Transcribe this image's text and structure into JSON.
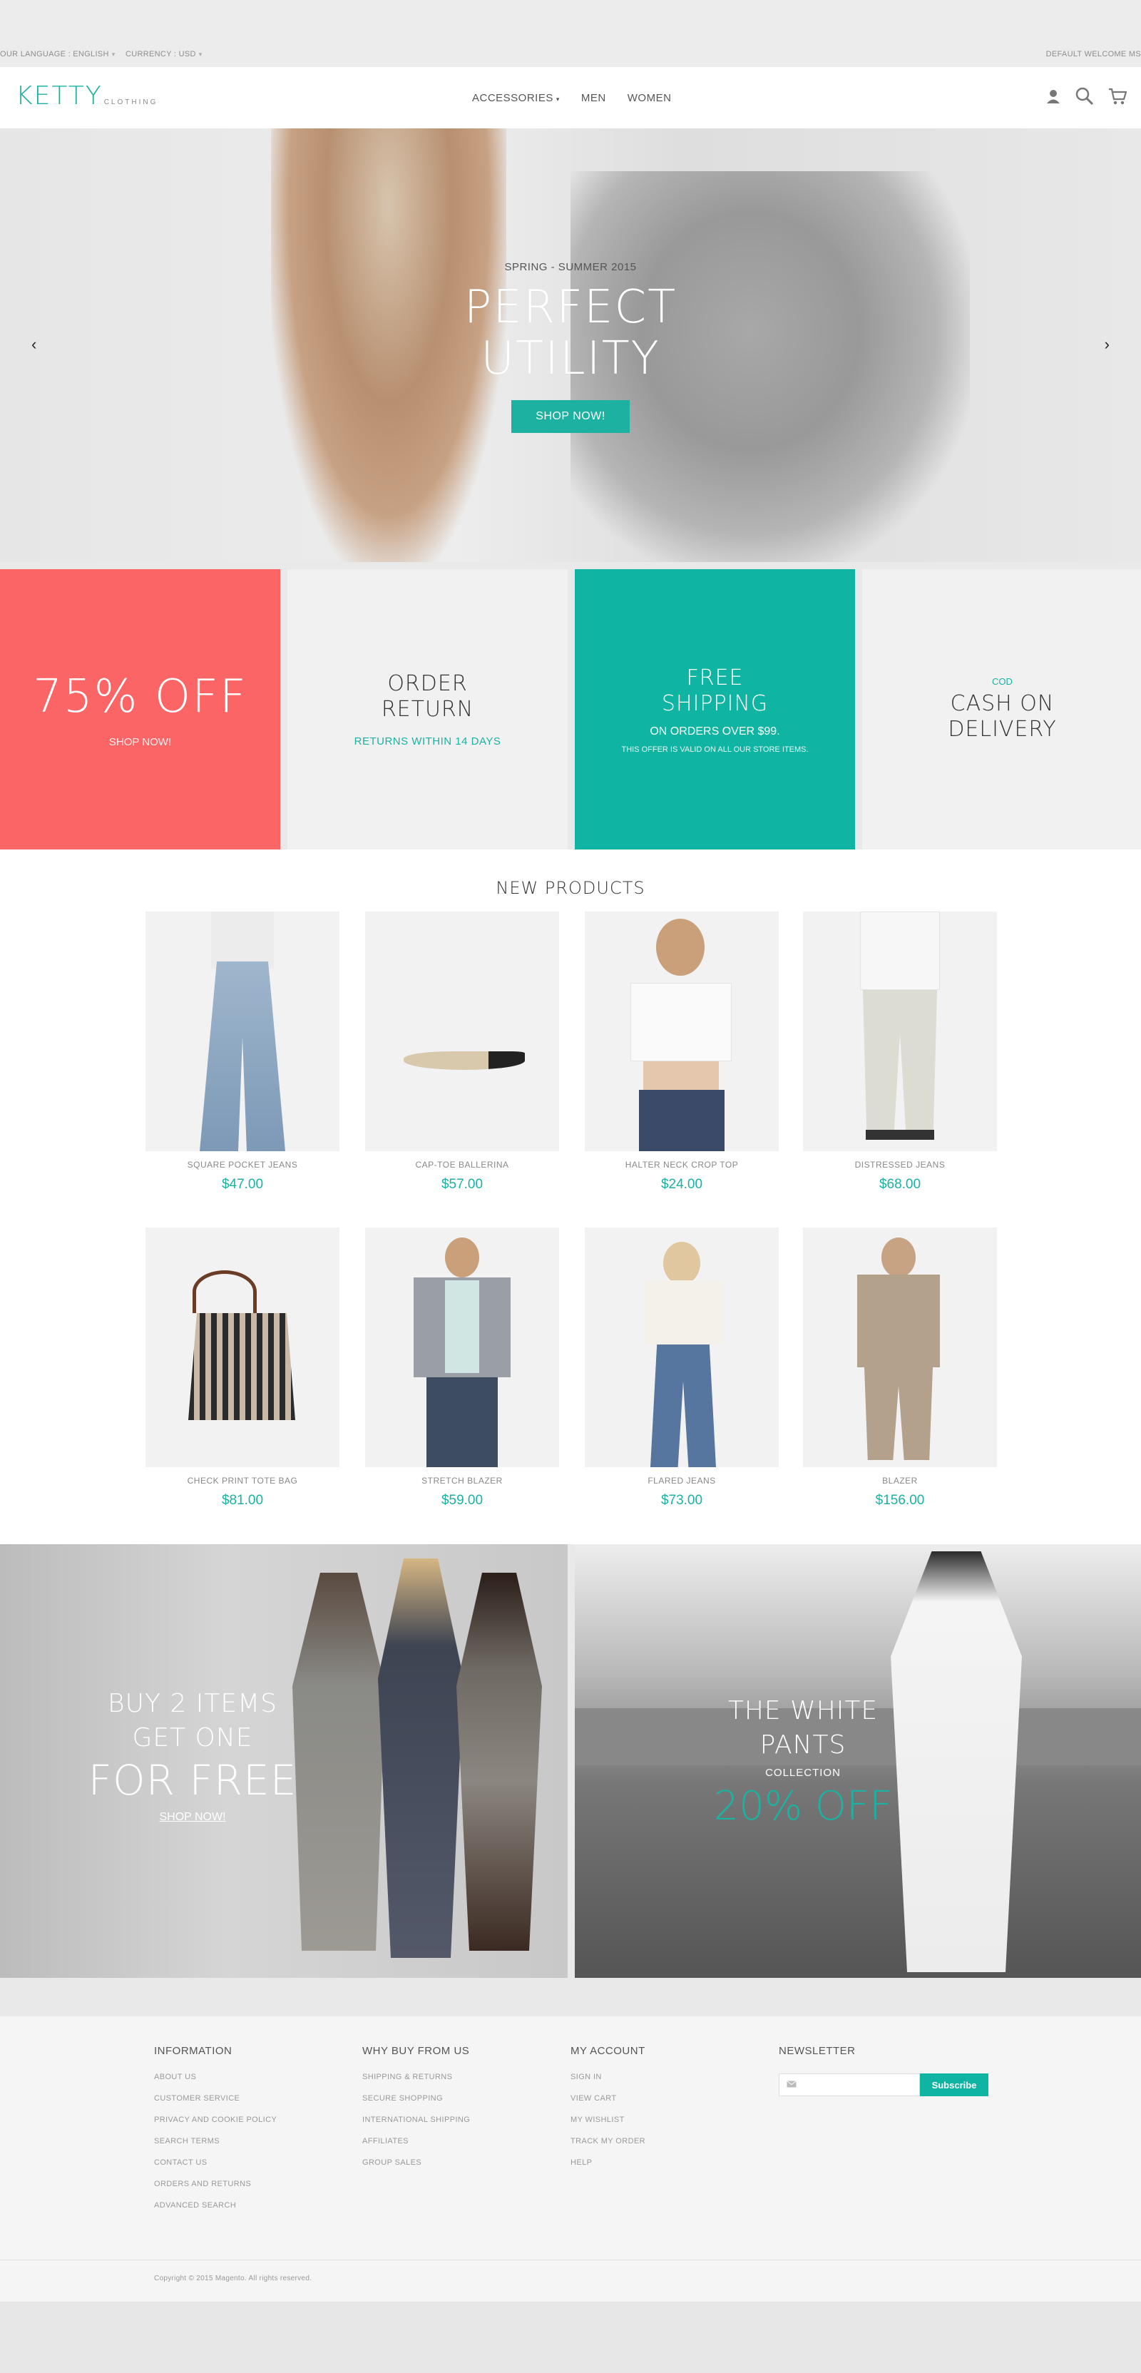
{
  "topbar": {
    "language": "OUR LANGUAGE : ENGLISH",
    "currency": "CURRENCY : USD",
    "welcome": "DEFAULT WELCOME MS"
  },
  "header": {
    "logo_main": "KETTY",
    "logo_sub": "CLOTHING",
    "nav": [
      "ACCESSORIES",
      "MEN",
      "WOMEN"
    ]
  },
  "hero": {
    "season": "SPRING - SUMMER 2015",
    "title_line1": "PERFECT",
    "title_line2": "UTILITY",
    "cta": "SHOP NOW!"
  },
  "promos": {
    "p1": {
      "big": "75% OFF",
      "small": "SHOP NOW!"
    },
    "p2": {
      "line1": "ORDER",
      "line2": "RETURN",
      "small": "RETURNS WITHIN 14 DAYS"
    },
    "p3": {
      "line1": "FREE",
      "line2": "SHIPPING",
      "small": "ON ORDERS OVER $99.",
      "tiny": "THIS OFFER IS VALID ON ALL OUR STORE ITEMS."
    },
    "p4": {
      "cod": "COD",
      "line1": "CASH ON",
      "line2": "DELIVERY"
    }
  },
  "products": {
    "heading": "NEW PRODUCTS",
    "items": [
      {
        "name": "SQUARE POCKET JEANS",
        "price": "$47.00"
      },
      {
        "name": "CAP-TOE BALLERINA",
        "price": "$57.00"
      },
      {
        "name": "HALTER NECK CROP TOP",
        "price": "$24.00"
      },
      {
        "name": "DISTRESSED JEANS",
        "price": "$68.00"
      },
      {
        "name": "CHECK PRINT TOTE BAG",
        "price": "$81.00"
      },
      {
        "name": "STRETCH BLAZER",
        "price": "$59.00"
      },
      {
        "name": "FLARED JEANS",
        "price": "$73.00"
      },
      {
        "name": "BLAZER",
        "price": "$156.00"
      }
    ]
  },
  "banners": {
    "b1": {
      "line1": "BUY 2 ITEMS",
      "line2": "GET ONE",
      "line3": "FOR FREE",
      "link": "SHOP NOW!"
    },
    "b2": {
      "line1": "THE WHITE",
      "line2": "PANTS",
      "collection": "COLLECTION",
      "off": "20% OFF"
    }
  },
  "footer": {
    "information": {
      "title": "INFORMATION",
      "links": [
        "ABOUT US",
        "CUSTOMER SERVICE",
        "PRIVACY AND COOKIE POLICY",
        "SEARCH TERMS",
        "CONTACT US",
        "ORDERS AND RETURNS",
        "ADVANCED SEARCH"
      ]
    },
    "why": {
      "title": "WHY BUY FROM US",
      "links": [
        "SHIPPING & RETURNS",
        "SECURE SHOPPING",
        "INTERNATIONAL SHIPPING",
        "AFFILIATES",
        "GROUP SALES"
      ]
    },
    "account": {
      "title": "MY ACCOUNT",
      "links": [
        "SIGN IN",
        "VIEW CART",
        "MY WISHLIST",
        "TRACK MY ORDER",
        "HELP"
      ]
    },
    "newsletter": {
      "title": "NEWSLETTER",
      "button": "Subscribe"
    },
    "copyright": "Copyright © 2015 Magento. All rights reserved."
  },
  "colors": {
    "accent": "#1cb1a0",
    "coral": "#fc6566"
  }
}
